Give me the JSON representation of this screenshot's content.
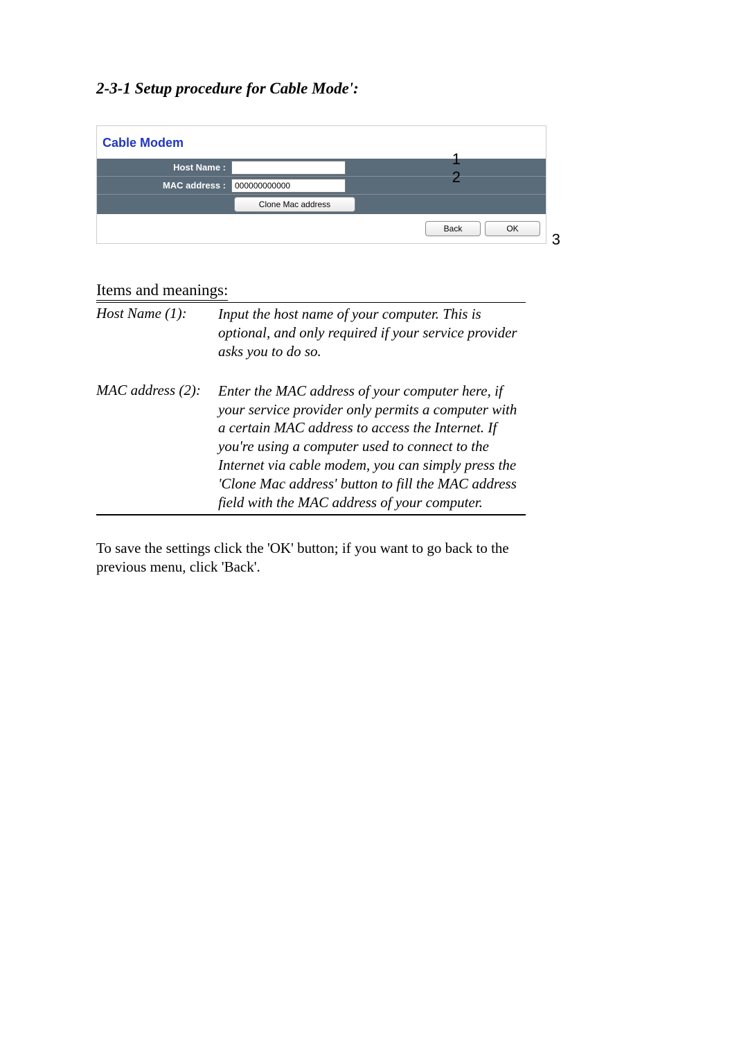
{
  "heading": "2-3-1 Setup procedure for Cable Mode':",
  "shot": {
    "title": "Cable Modem",
    "host_label": "Host Name :",
    "host_value": "",
    "mac_label": "MAC address :",
    "mac_value": "000000000000",
    "clone_btn": "Clone Mac address",
    "back_btn": "Back",
    "ok_btn": "OK",
    "c1": "1",
    "c2": "2",
    "c3": "3"
  },
  "items_heading": "Items and meanings:",
  "items": [
    {
      "term": "Host Name (1):",
      "def": "Input the host name of your computer. This is optional, and only required if your service provider asks you to do so."
    },
    {
      "term": "MAC address (2):",
      "def": "Enter the MAC address of your computer here, if your service provider only permits a computer with a certain MAC address to access the Internet. If you're using a computer used to connect to the Internet via cable modem, you can simply press the 'Clone Mac address' button to fill the MAC address field with the MAC address of your computer."
    }
  ],
  "save_para": "To save the settings click the 'OK' button; if you want to go back to the previous menu, click 'Back'."
}
